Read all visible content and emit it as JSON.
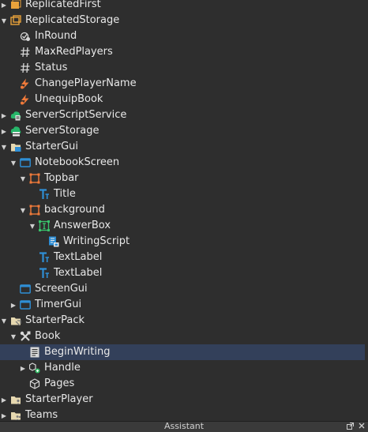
{
  "explorer": {
    "rows": [
      {
        "label": "ReplicatedFirst",
        "depth": 0,
        "arrow": "right",
        "icon": "replicated-first-icon"
      },
      {
        "label": "ReplicatedStorage",
        "depth": 0,
        "arrow": "down",
        "icon": "replicated-storage-icon"
      },
      {
        "label": "InRound",
        "depth": 1,
        "arrow": "",
        "icon": "bool-value-icon"
      },
      {
        "label": "MaxRedPlayers",
        "depth": 1,
        "arrow": "",
        "icon": "number-value-icon"
      },
      {
        "label": "Status",
        "depth": 1,
        "arrow": "",
        "icon": "number-value-icon"
      },
      {
        "label": "ChangePlayerName",
        "depth": 1,
        "arrow": "",
        "icon": "remote-event-icon"
      },
      {
        "label": "UnequipBook",
        "depth": 1,
        "arrow": "",
        "icon": "remote-event-icon"
      },
      {
        "label": "ServerScriptService",
        "depth": 0,
        "arrow": "right",
        "icon": "server-script-service-icon"
      },
      {
        "label": "ServerStorage",
        "depth": 0,
        "arrow": "right",
        "icon": "server-storage-icon"
      },
      {
        "label": "StarterGui",
        "depth": 0,
        "arrow": "down",
        "icon": "folder-gui-icon"
      },
      {
        "label": "NotebookScreen",
        "depth": 1,
        "arrow": "down",
        "icon": "screen-gui-icon"
      },
      {
        "label": "Topbar",
        "depth": 2,
        "arrow": "down",
        "icon": "frame-icon"
      },
      {
        "label": "Title",
        "depth": 3,
        "arrow": "",
        "icon": "text-label-icon"
      },
      {
        "label": "background",
        "depth": 2,
        "arrow": "down",
        "icon": "frame-icon"
      },
      {
        "label": "AnswerBox",
        "depth": 3,
        "arrow": "down",
        "icon": "text-box-icon"
      },
      {
        "label": "WritingScript",
        "depth": 4,
        "arrow": "",
        "icon": "local-script-icon"
      },
      {
        "label": "TextLabel",
        "depth": 3,
        "arrow": "",
        "icon": "text-label-icon"
      },
      {
        "label": "TextLabel",
        "depth": 3,
        "arrow": "",
        "icon": "text-label-icon"
      },
      {
        "label": "ScreenGui",
        "depth": 1,
        "arrow": "",
        "icon": "screen-gui-icon"
      },
      {
        "label": "TimerGui",
        "depth": 1,
        "arrow": "right",
        "icon": "screen-gui-icon"
      },
      {
        "label": "StarterPack",
        "depth": 0,
        "arrow": "down",
        "icon": "folder-pack-icon"
      },
      {
        "label": "Book",
        "depth": 1,
        "arrow": "down",
        "icon": "tool-icon"
      },
      {
        "label": "BeginWriting",
        "depth": 2,
        "arrow": "",
        "icon": "script-icon",
        "selected": true
      },
      {
        "label": "Handle",
        "depth": 2,
        "arrow": "right",
        "icon": "part-handle-icon"
      },
      {
        "label": "Pages",
        "depth": 2,
        "arrow": "",
        "icon": "part-icon"
      },
      {
        "label": "StarterPlayer",
        "depth": 0,
        "arrow": "right",
        "icon": "folder-player-icon"
      },
      {
        "label": "Teams",
        "depth": 0,
        "arrow": "right",
        "icon": "teams-icon"
      }
    ]
  },
  "bottom_panel": {
    "title": "Assistant",
    "popout_icon": "popout-icon",
    "close_icon": "close-icon"
  },
  "colors": {
    "background": "#2e2e2e",
    "selected_row": "#33405a",
    "text": "#e8e8e8"
  }
}
